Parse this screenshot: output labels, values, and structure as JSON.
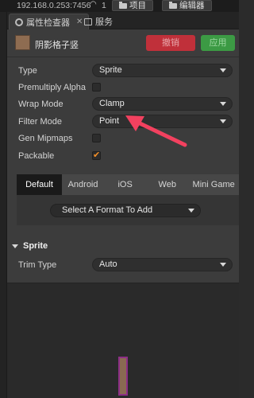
{
  "topbar": {
    "ip": "192.168.0.253:7456",
    "signal_count": "1",
    "project_button": "项目",
    "editor_button": "编辑器"
  },
  "tabs": {
    "inspector": "属性检查器",
    "services": "服务"
  },
  "asset": {
    "name": "阴影格子竖",
    "revert": "撤销",
    "apply": "应用"
  },
  "props": {
    "type_label": "Type",
    "type_value": "Sprite",
    "premultiply_label": "Premultiply Alpha",
    "premultiply_checked": false,
    "wrap_label": "Wrap Mode",
    "wrap_value": "Clamp",
    "filter_label": "Filter Mode",
    "filter_value": "Point",
    "mipmaps_label": "Gen Mipmaps",
    "mipmaps_checked": false,
    "packable_label": "Packable",
    "packable_checked": true
  },
  "platforms": {
    "tabs": [
      "Default",
      "Android",
      "iOS",
      "Web",
      "Mini Game"
    ],
    "active": "Default",
    "format_placeholder": "Select A Format To Add"
  },
  "sprite_section": {
    "title": "Sprite",
    "trim_label": "Trim Type",
    "trim_value": "Auto"
  },
  "colors": {
    "accent_checkbox": "#f28f28",
    "revert_button": "#c0303a",
    "apply_button": "#3c9a44",
    "annotation_arrow": "#f2415f"
  }
}
